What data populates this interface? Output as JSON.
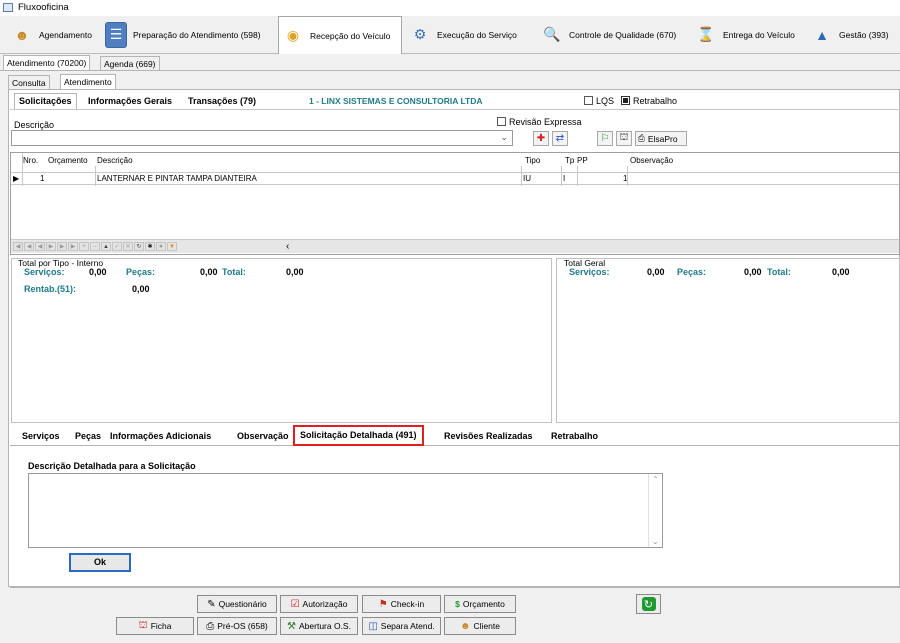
{
  "window": {
    "title": "Fluxooficina"
  },
  "main_nav": [
    {
      "label": "Agendamento",
      "icon": "person-icon"
    },
    {
      "label": "Preparação do Atendimento (598)",
      "icon": "form-icon"
    },
    {
      "label": "Recepção do Veículo",
      "icon": "location-pin-icon"
    },
    {
      "label": "Execução do Serviço",
      "icon": "mechanic-icon"
    },
    {
      "label": "Controle de Qualidade (670)",
      "icon": "inspection-icon"
    },
    {
      "label": "Entrega do Veículo",
      "icon": "hourglass-icon"
    },
    {
      "label": "Gestão (393)",
      "icon": "chart-icon"
    }
  ],
  "subtabs": {
    "atendimento": "Atendimento (70200)",
    "agenda": "Agenda (669)"
  },
  "tabs2": {
    "consulta": "Consulta",
    "atendimento": "Atendimento"
  },
  "tabs3": {
    "solicitacoes": "Solicitações",
    "informacoes": "Informações Gerais",
    "transacoes": "Transações (79)"
  },
  "company": "1 - LINX SISTEMAS E CONSULTORIA LTDA",
  "checkboxes": {
    "lqs": "LQS",
    "retrabalho": "Retrabalho",
    "revisao": "Revisão Expressa"
  },
  "descricao": {
    "label": "Descrição",
    "value": ""
  },
  "elsapro_label": "ElsaPro",
  "grid": {
    "headers": {
      "nro": "Nro.",
      "orcamento": "Orçamento",
      "descricao": "Descrição",
      "tipo": "Tipo",
      "tp": "Tp",
      "pp": "PP",
      "observacao": "Observação"
    },
    "row": {
      "nro": "1",
      "orcamento": "",
      "descricao": "LANTERNAR E PINTAR TAMPA DIANTEIRA",
      "tipo": "IU",
      "tp": "I",
      "pp": "1",
      "observacao": ""
    }
  },
  "totals_left": {
    "title": "Total por Tipo - Interno",
    "servicos_label": "Serviços:",
    "servicos": "0,00",
    "pecas_label": "Peças:",
    "pecas": "0,00",
    "total_label": "Total:",
    "total": "0,00",
    "rentab_label": "Rentab.(51):",
    "rentab": "0,00"
  },
  "totals_right": {
    "title": "Total Geral",
    "servicos_label": "Serviços:",
    "servicos": "0,00",
    "pecas_label": "Peças:",
    "pecas": "0,00",
    "total_label": "Total:",
    "total": "0,00"
  },
  "bottom_tabs": {
    "servicos": "Serviços",
    "pecas": "Peças",
    "info": "Informações Adicionais",
    "observacao": "Observação",
    "solicitacao": "Solicitação Detalhada (491)",
    "revisoes": "Revisões Realizadas",
    "retrabalho": "Retrabalho"
  },
  "detalhada": {
    "label": "Descrição Detalhada para a Solicitação",
    "value": "",
    "ok": "Ok"
  },
  "actions": {
    "questionario": "Questionário",
    "autorizacao": "Autorização",
    "checkin": "Check-in",
    "orcamento": "Orçamento",
    "ficha": "Ficha",
    "preos": "Pré-OS (658)",
    "abertura": "Abertura O.S.",
    "separa": "Separa Atend.",
    "cliente": "Cliente"
  },
  "colors": {
    "teal": "#1f7a8a",
    "highlight": "#e02020",
    "active_tab": "#ffffff"
  }
}
